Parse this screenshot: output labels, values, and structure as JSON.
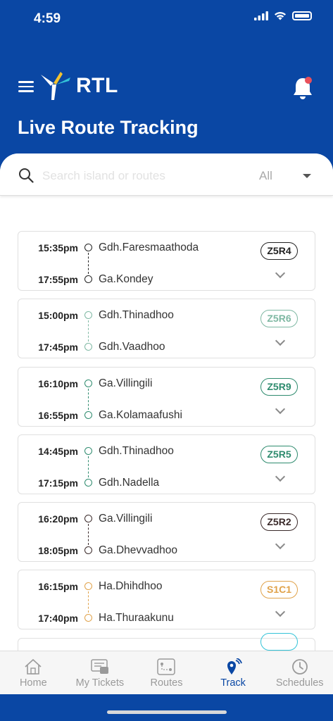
{
  "status_bar": {
    "time": "4:59"
  },
  "header": {
    "brand": "RTL",
    "title": "Live Route Tracking"
  },
  "search": {
    "placeholder": "Search island or routes",
    "filter_value": "All"
  },
  "colors": {
    "brand_blue": "#0a47a4",
    "route_black": "#222222",
    "route_green": "#2e8b6e",
    "route_orange": "#e0a24a",
    "route_teal": "#33c3d8",
    "notification_dot": "#e8505b"
  },
  "routes": [
    {
      "depart_time": "15:35pm",
      "arrive_time": "17:55pm",
      "from": "Gdh.Faresmaathoda",
      "to": "Ga.Kondey",
      "code": "Z5R4",
      "color": "#222222"
    },
    {
      "depart_time": "15:00pm",
      "arrive_time": "17:45pm",
      "from": "Gdh.Thinadhoo",
      "to": "Gdh.Vaadhoo",
      "code": "Z5R6",
      "color": "#7fb8a3"
    },
    {
      "depart_time": "16:10pm",
      "arrive_time": "16:55pm",
      "from": "Ga.Villingili",
      "to": "Ga.Kolamaafushi",
      "code": "Z5R9",
      "color": "#2e8b6e"
    },
    {
      "depart_time": "14:45pm",
      "arrive_time": "17:15pm",
      "from": "Gdh.Thinadhoo",
      "to": "Gdh.Nadella",
      "code": "Z5R5",
      "color": "#2e8b6e"
    },
    {
      "depart_time": "16:20pm",
      "arrive_time": "18:05pm",
      "from": "Ga.Villingili",
      "to": "Ga.Dhevvadhoo",
      "code": "Z5R2",
      "color": "#3a2a2a"
    },
    {
      "depart_time": "16:15pm",
      "arrive_time": "17:40pm",
      "from": "Ha.Dhihdhoo",
      "to": "Ha.Thuraakunu",
      "code": "S1C1",
      "color": "#e0a24a"
    }
  ],
  "tabs": [
    {
      "label": "Home",
      "icon": "home-icon",
      "active": false
    },
    {
      "label": "My Tickets",
      "icon": "tickets-icon",
      "active": false
    },
    {
      "label": "Routes",
      "icon": "routes-icon",
      "active": false
    },
    {
      "label": "Track",
      "icon": "track-icon",
      "active": true
    },
    {
      "label": "Schedules",
      "icon": "clock-icon",
      "active": false
    }
  ]
}
